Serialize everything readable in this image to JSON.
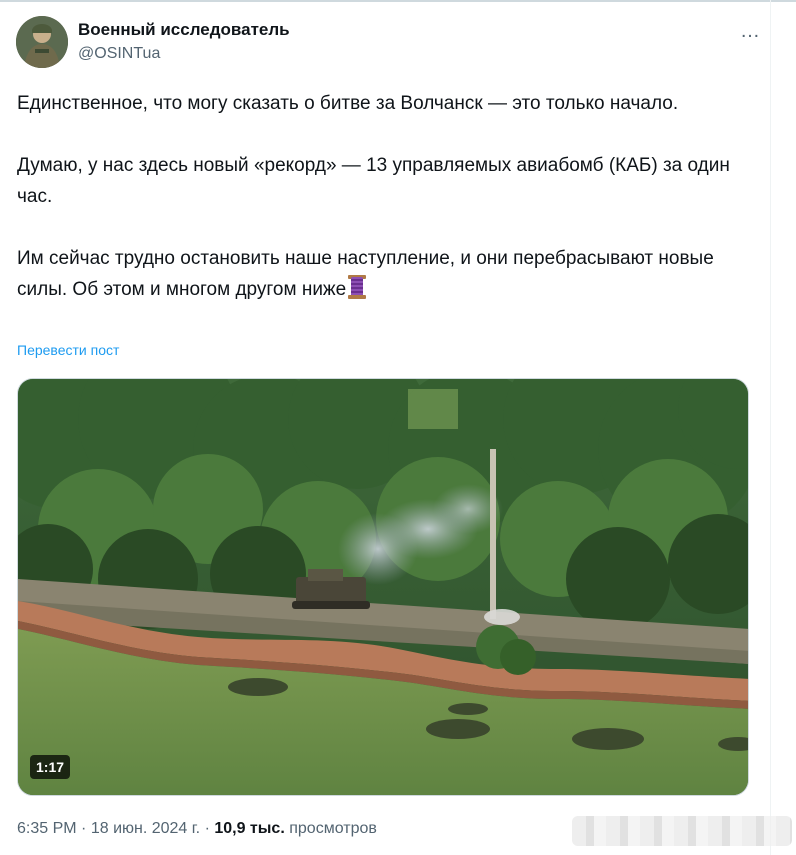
{
  "author": {
    "display_name": "Военный исследователь",
    "handle": "@OSINTua",
    "avatar_icon": "avatar-image"
  },
  "more_icon": "…",
  "tweet": {
    "paragraph_1": "Единственное, что могу сказать о битве за Волчанск — это только начало.",
    "paragraph_2": "Думаю, у нас здесь новый «рекорд» — 13 управляемых авиабомб (КАБ) за один час.",
    "paragraph_3": "Им сейчас трудно остановить наше наступление, и они перебрасывают новые силы. Об этом и многом другом ниже",
    "thread_emoji": "thread-spool-icon"
  },
  "translate_link": "Перевести пост",
  "media": {
    "duration": "1:17",
    "kind": "video-thumbnail"
  },
  "meta": {
    "time": "6:35 PM",
    "separator": "·",
    "date": "18 июн. 2024 г.",
    "views_count": "10,9 тыс.",
    "views_label": "просмотров"
  },
  "colors": {
    "text": "#0f1419",
    "secondary": "#536471",
    "link": "#1d9bf0"
  }
}
